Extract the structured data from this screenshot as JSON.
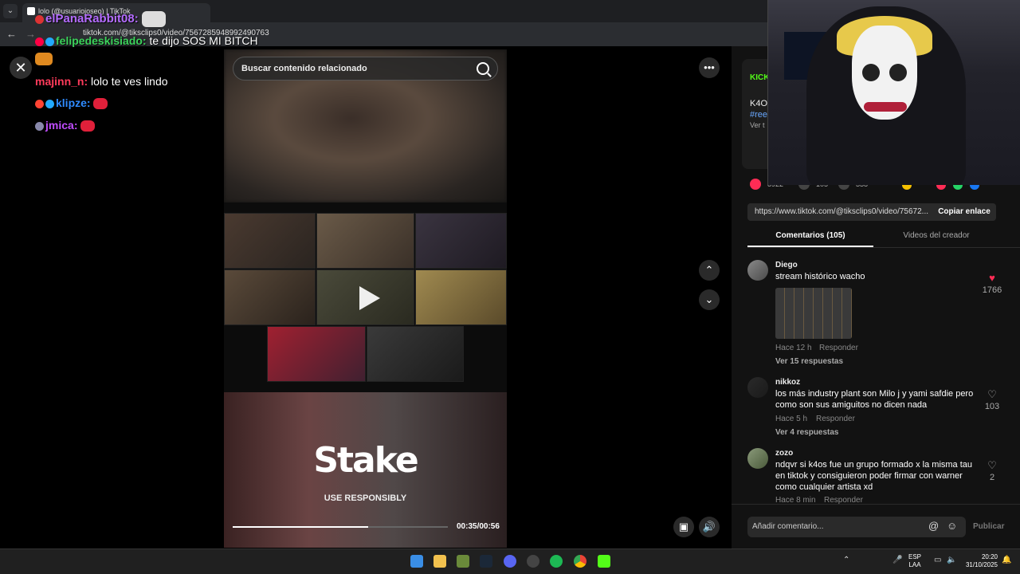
{
  "browser": {
    "tab_title": "lolo (@usuariojoseo) | TikTok",
    "url": "tiktok.com/@tiksclips0/video/7567285948992490763"
  },
  "chat": [
    {
      "user": "elPanaRabbit08",
      "message": ""
    },
    {
      "user": "felipedeskisiado",
      "message": "te dijo SOS MI BITCH"
    },
    {
      "user": "majinn_n",
      "message": "lolo te ves lindo"
    },
    {
      "user": "klipze",
      "message": ""
    },
    {
      "user": "jmica",
      "message": ""
    }
  ],
  "video": {
    "search_placeholder": "Buscar contenido relacionado",
    "ad_brand": "Stake",
    "ad_tagline": "USE RESPONSIBLY",
    "time": "00:35/00:56",
    "progress": 0.63
  },
  "panel": {
    "source_label": "KICK",
    "author_short": "K4O",
    "hashtag": "#ree",
    "see_more": "Ver t",
    "stats": [
      "8922",
      "105",
      "338"
    ],
    "share_url": "https://www.tiktok.com/@tiksclips0/video/75672...",
    "copy_label": "Copiar enlace",
    "tabs": [
      "Comentarios (105)",
      "Videos del creador"
    ],
    "comments": [
      {
        "user": "Diego",
        "text": "stream histórico wacho",
        "time": "Hace 12 h",
        "reply": "Responder",
        "replies": "Ver 15 respuestas",
        "likes": "1766",
        "liked": true
      },
      {
        "user": "nikkoz",
        "text": "los más industry plant son Milo j y yami safdie pero como son sus amiguitos no dicen nada",
        "time": "Hace 5 h",
        "reply": "Responder",
        "replies": "Ver 4 respuestas",
        "likes": "103",
        "liked": false
      },
      {
        "user": "zozo",
        "text": "ndqvr si k4os fue un grupo formado x la misma tau en tiktok y consiguieron poder firmar con warner como cualquier artista xd",
        "time": "Hace 8 min",
        "reply": "Responder",
        "replies": "",
        "likes": "2",
        "liked": false
      }
    ],
    "comment_placeholder": "Añadir comentario...",
    "publish_label": "Publicar"
  },
  "taskbar": {
    "lang_line1": "ESP",
    "lang_line2": "LAA",
    "time": "20:20",
    "date": "31/10/2025"
  },
  "colors": {
    "accent_red": "#fe2c55",
    "kick_green": "#53fc18"
  }
}
